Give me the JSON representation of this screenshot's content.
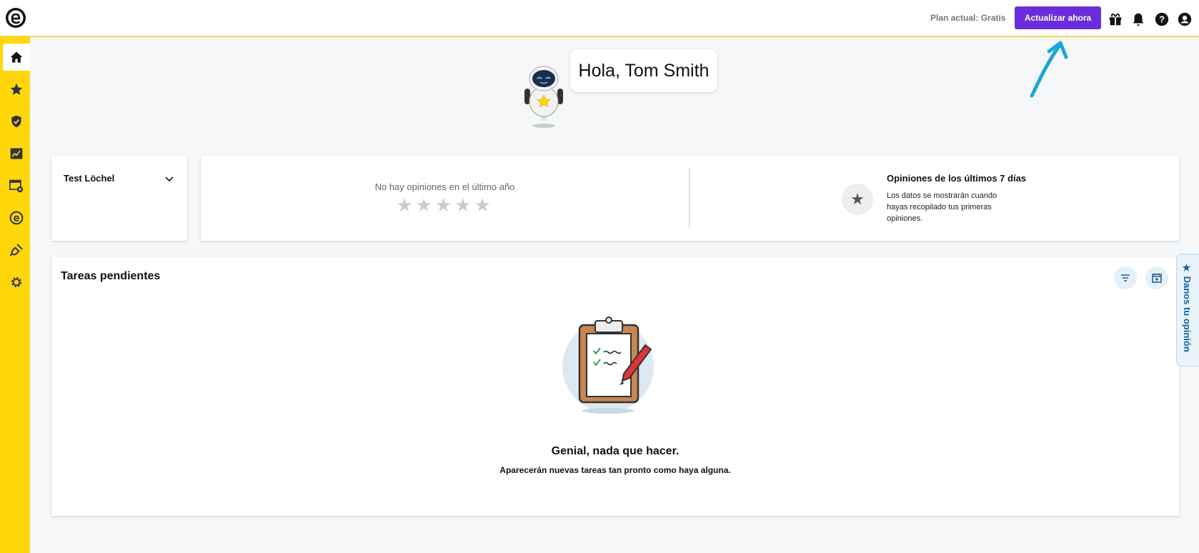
{
  "header": {
    "plan_label": "Plan actual: Gratis",
    "upgrade_label": "Actualizar ahora",
    "icons": [
      "gift-icon",
      "bell-icon",
      "help-icon",
      "account-icon"
    ]
  },
  "sidebar": {
    "items": [
      {
        "icon": "home-icon",
        "active": true
      },
      {
        "icon": "star-icon"
      },
      {
        "icon": "shield-check-icon"
      },
      {
        "icon": "chart-icon"
      },
      {
        "icon": "browser-add-icon"
      },
      {
        "icon": "trustedshops-e-icon"
      },
      {
        "icon": "plug-icon"
      },
      {
        "icon": "gear-icon"
      }
    ]
  },
  "greeting": {
    "text": "Hola, Tom Smith"
  },
  "location": {
    "name": "Test Löchel"
  },
  "reviews": {
    "empty_label": "No hay opiniones en el último año",
    "stars": "★★★★★",
    "last7_title": "Opiniones de los últimos 7 días",
    "last7_desc": "Los datos se mostrarán cuando hayas recopilado tus primeras opiniones."
  },
  "tasks": {
    "title": "Tareas pendientes",
    "empty_title": "Genial, nada que hacer.",
    "empty_subtitle": "Aparecerán nuevas tareas tan pronto como haya alguna."
  },
  "feedback": {
    "label": "★  Danos tu opinión"
  },
  "colors": {
    "accent": "#6b2ddb",
    "sidebar": "#ffd70b",
    "annotation_arrow": "#1aa7d8"
  }
}
